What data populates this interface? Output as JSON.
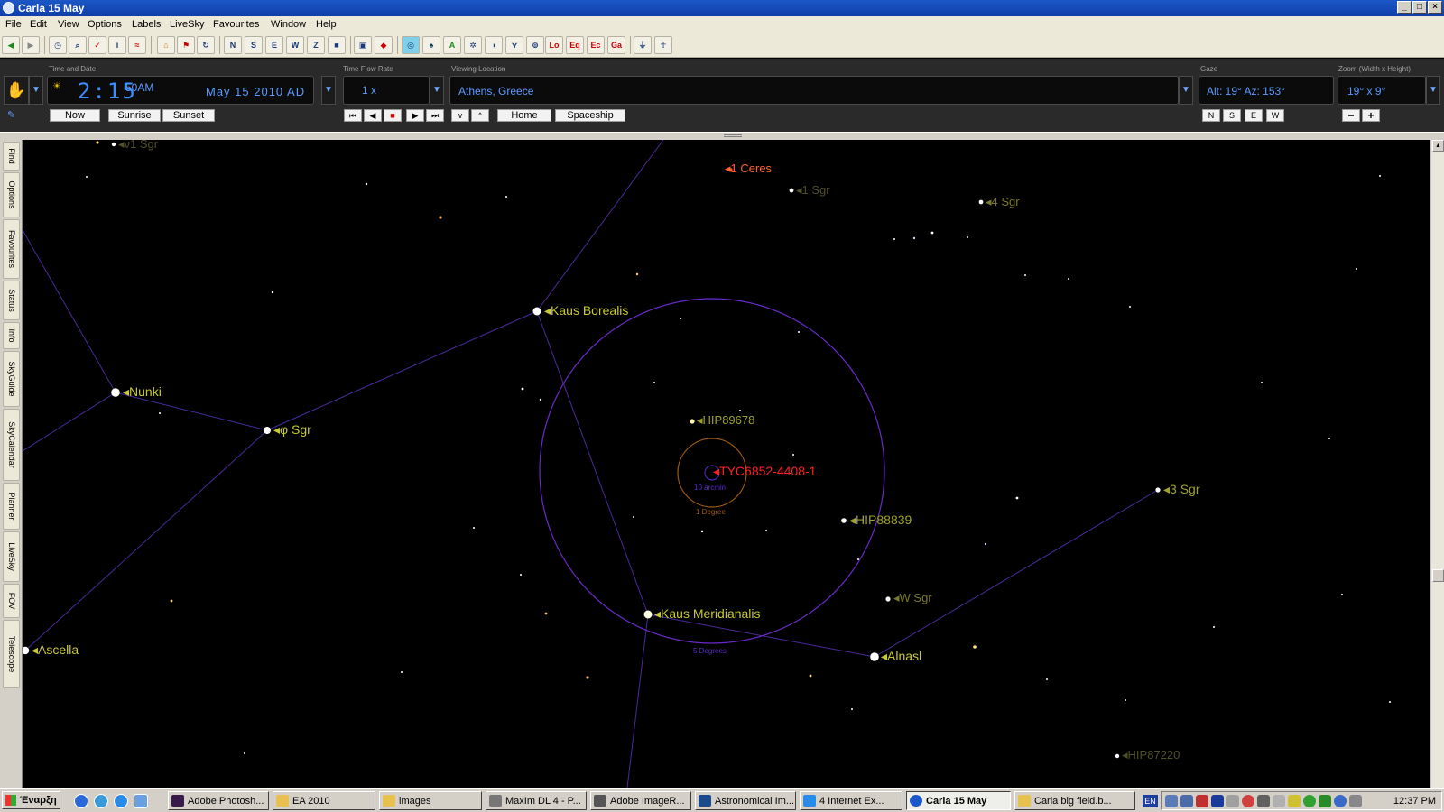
{
  "window": {
    "title": "Carla 15 May"
  },
  "menu": [
    "File",
    "Edit",
    "View",
    "Options",
    "Labels",
    "LiveSky",
    "Favourites",
    "Window",
    "Help"
  ],
  "toolbar": {
    "letter_buttons": [
      "N",
      "S",
      "E",
      "W",
      "Z",
      "Lo",
      "Eq",
      "Ec",
      "Ga"
    ]
  },
  "controls": {
    "time_label": "Time and Date",
    "time": "2:15",
    "ampm": "50AM",
    "date": "May 15   2010 AD",
    "flow_label": "Time Flow Rate",
    "flow": "1 x",
    "location_label": "Viewing Location",
    "location": "Athens, Greece",
    "gaze_label": "Gaze",
    "gaze": "Alt: 19° Az: 153°",
    "zoom_label": "Zoom (Width x Height)",
    "zoom": "19° x 9°",
    "buttons": {
      "now": "Now",
      "sunrise": "Sunrise",
      "sunset": "Sunset",
      "home": "Home",
      "spaceship": "Spaceship",
      "n": "N",
      "s": "S",
      "e": "E",
      "w": "W",
      "zoom_out": "−",
      "zoom_in": "+"
    }
  },
  "side_tabs": [
    "Find",
    "Options",
    "Favourites",
    "Status",
    "Info",
    "SkyGuide",
    "SkyCalendar",
    "Planner",
    "LiveSky",
    "FOV",
    "Telescope"
  ],
  "sky": {
    "labels": {
      "nu1_sgr": "ν1 Sgr",
      "ceres": "1 Ceres",
      "one_sgr": "1 Sgr",
      "four_sgr": "4 Sgr",
      "kaus_borealis": "Kaus Borealis",
      "nunki": "Nunki",
      "phi_sgr": "φ Sgr",
      "hip89678": "HIP89678",
      "tyc": "TYC6852-4408-1",
      "three_sgr": "3 Sgr",
      "hip88839": "HIP88839",
      "w_sgr": "W Sgr",
      "kaus_meridianalis": "Kaus Meridianalis",
      "alnasl": "Alnasl",
      "ascella": "Ascella",
      "hip87220": "HIP87220"
    },
    "fov_labels": {
      "ten_arcmin": "10 arcmin",
      "one_degree": "1 Degree",
      "five_degrees": "5 Degrees"
    },
    "colors": {
      "constellation_line": "#4a2a9a",
      "star_label": "#c8c832",
      "ceres": "#ff6030",
      "target": "#ff2020",
      "fov_ring": "#6a2acc",
      "one_degree_ring": "#a05a10"
    }
  },
  "taskbar": {
    "start": "Έναρξη",
    "tasks": [
      "Adobe Photosh...",
      "EA 2010",
      "images",
      "MaxIm DL 4 - P...",
      "Adobe ImageR...",
      "Astronomical Im...",
      "4 Internet Ex...",
      "Carla 15 May",
      "Carla big field.b..."
    ],
    "language": "EN",
    "clock": "12:37 PM"
  }
}
